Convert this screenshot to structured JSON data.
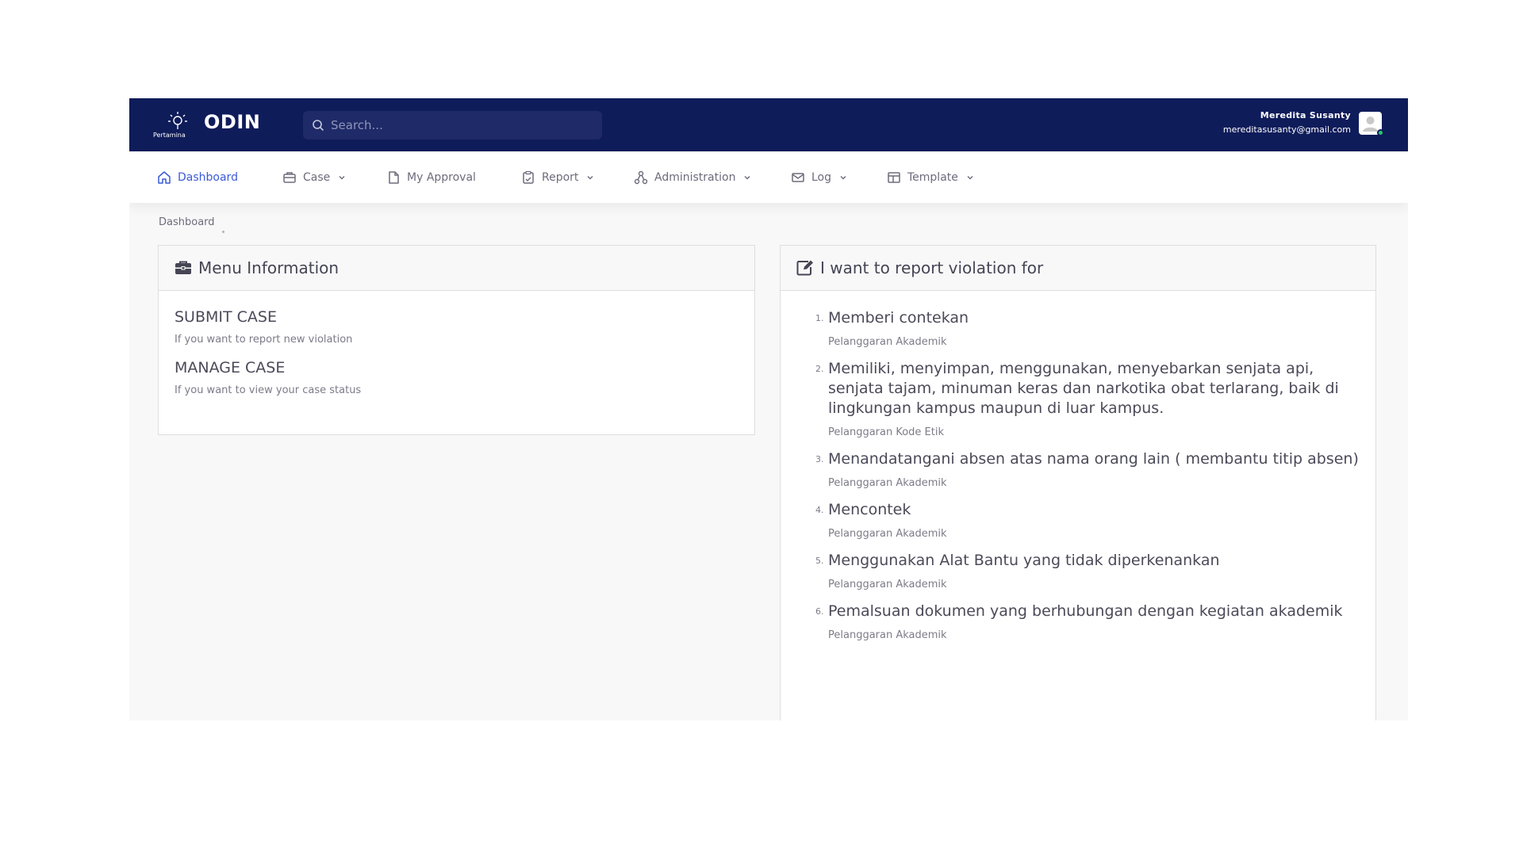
{
  "app": {
    "name": "ODIN",
    "logo_text": "Pertamina"
  },
  "search": {
    "placeholder": "Search..."
  },
  "user": {
    "name": "Meredita Susanty",
    "email": "mereditasusanty@gmail.com"
  },
  "nav": {
    "dashboard": "Dashboard",
    "case": "Case",
    "approval": "My Approval",
    "report": "Report",
    "administration": "Administration",
    "log": "Log",
    "template": "Template"
  },
  "breadcrumb": "Dashboard",
  "menu_info": {
    "title": "Menu Information",
    "items": [
      {
        "title": "SUBMIT CASE",
        "desc": "If you want to report new violation"
      },
      {
        "title": "MANAGE CASE",
        "desc": "If you want to view your case status"
      }
    ]
  },
  "violations": {
    "title": "I want to report violation for",
    "items": [
      {
        "num": "1.",
        "title": "Memberi contekan",
        "category": "Pelanggaran Akademik"
      },
      {
        "num": "2.",
        "title": "Memiliki, menyimpan, menggunakan, menyebarkan senjata api, senjata tajam, minuman keras dan narkotika obat terlarang, baik di lingkungan kampus maupun di luar kampus.",
        "category": "Pelanggaran Kode Etik"
      },
      {
        "num": "3.",
        "title": "Menandatangani absen atas nama orang lain ( membantu titip absen)",
        "category": "Pelanggaran Akademik"
      },
      {
        "num": "4.",
        "title": "Mencontek",
        "category": "Pelanggaran Akademik"
      },
      {
        "num": "5.",
        "title": "Menggunakan Alat Bantu yang tidak diperkenankan",
        "category": "Pelanggaran Akademik"
      },
      {
        "num": "6.",
        "title": "Pemalsuan dokumen yang berhubungan dengan kegiatan akademik",
        "category": "Pelanggaran Akademik"
      }
    ]
  },
  "colors": {
    "topbar": "#0f1c5a",
    "accent": "#3b5ad6",
    "online": "#28c76f"
  }
}
